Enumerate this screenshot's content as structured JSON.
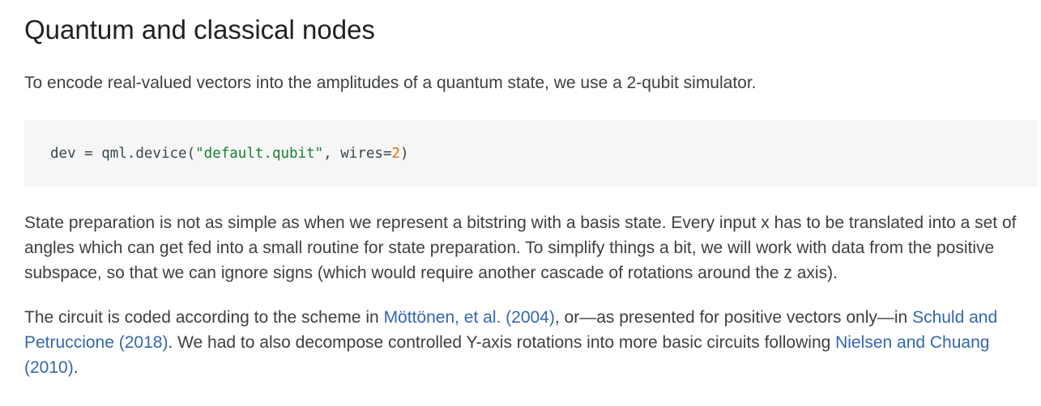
{
  "heading": "Quantum and classical nodes",
  "intro": "To encode real-valued vectors into the amplitudes of a quantum state, we use a 2-qubit simulator.",
  "code": {
    "var": "dev",
    "eq": " = ",
    "call": "qml.device(",
    "string": "\"default.qubit\"",
    "sep": ", ",
    "kw": "wires",
    "kw_eq": "=",
    "num": "2",
    "close": ")"
  },
  "state_prep": "State preparation is not as simple as when we represent a bitstring with a basis state. Every input x has to be translated into a set of angles which can get fed into a small routine for state preparation. To simplify things a bit, we will work with data from the positive subspace, so that we can ignore signs (which would require another cascade of rotations around the z axis).",
  "circuit": {
    "t1": "The circuit is coded according to the scheme in ",
    "link1": "Möttönen, et al. (2004)",
    "t2": ", or—as presented for positive vectors only—in ",
    "link2": "Schuld and Petruccione (2018)",
    "t3": ". We had to also decompose controlled Y-axis rotations into more basic circuits following ",
    "link3": "Nielsen and Chuang (2010)",
    "t4": "."
  }
}
